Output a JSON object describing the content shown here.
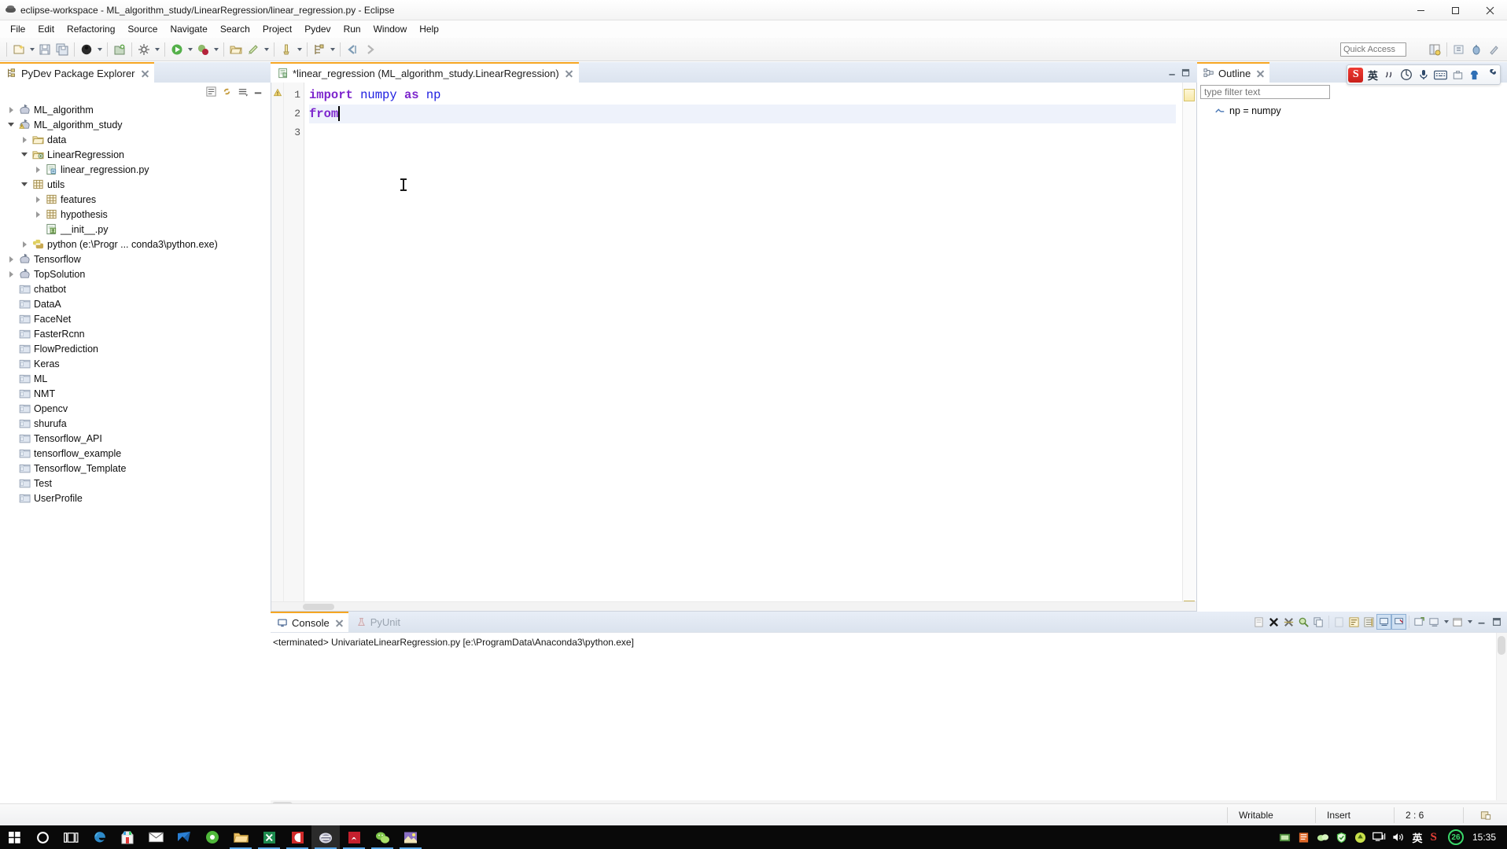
{
  "window": {
    "title": "eclipse-workspace - ML_algorithm_study/LinearRegression/linear_regression.py - Eclipse",
    "app_icon": "eclipse-icon",
    "minimize_label": "—",
    "maximize_label": "□",
    "close_label": "✕"
  },
  "menubar": {
    "items": [
      {
        "label": "File",
        "mnemonic": "F"
      },
      {
        "label": "Edit",
        "mnemonic": "E"
      },
      {
        "label": "Refactoring",
        "mnemonic": "a"
      },
      {
        "label": "Source",
        "mnemonic": "S"
      },
      {
        "label": "Navigate",
        "mnemonic": "N"
      },
      {
        "label": "Search",
        "mnemonic": "a"
      },
      {
        "label": "Project",
        "mnemonic": "P"
      },
      {
        "label": "Pydev",
        "mnemonic": "y"
      },
      {
        "label": "Run",
        "mnemonic": "R"
      },
      {
        "label": "Window",
        "mnemonic": "W"
      },
      {
        "label": "Help",
        "mnemonic": "H"
      }
    ]
  },
  "toolbar": {
    "buttons": [
      "new-wizard-icon",
      "new-dropdown-arrow",
      "save-icon",
      "save-all-icon",
      "debug-perspective-icon",
      "debug-dropdown-arrow",
      "new-python-project-icon",
      "customize-perspective-icon",
      "customize-dropdown-arrow",
      "run-icon",
      "run-dropdown-arrow",
      "debug-icon",
      "debug-menu-arrow",
      "open-folder-icon",
      "external-tools-icon",
      "external-tools-arrow",
      "pydev-run-icon",
      "pydev-run-arrow",
      "pydev-package-icon",
      "pydev-package-arrow",
      "back-icon",
      "forward-icon"
    ],
    "quick_access_placeholder": "Quick Access",
    "right_buttons": [
      "open-perspective-icon",
      "pydev-perspective-icon",
      "debug-perspective-2-icon",
      "java-perspective-icon"
    ]
  },
  "explorer": {
    "tab_title": "PyDev Package Explorer",
    "tab_icon": "pydev-package-explorer-icon",
    "close_icon": "close-icon",
    "toolbar_buttons": [
      "collapse-all-icon",
      "link-with-editor-icon",
      "view-menu-icon",
      "minimize-icon"
    ],
    "tree": [
      {
        "label": "ML_algorithm",
        "indent": 0,
        "twisty": "collapsed",
        "icon": "pydev-project-icon"
      },
      {
        "label": "ML_algorithm_study",
        "indent": 0,
        "twisty": "expanded",
        "icon": "pydev-project-warning-icon"
      },
      {
        "label": "data",
        "indent": 1,
        "twisty": "collapsed",
        "icon": "folder-icon"
      },
      {
        "label": "LinearRegression",
        "indent": 1,
        "twisty": "expanded",
        "icon": "source-folder-icon"
      },
      {
        "label": "linear_regression.py",
        "indent": 2,
        "twisty": "collapsed",
        "icon": "python-file-icon"
      },
      {
        "label": "utils",
        "indent": 1,
        "twisty": "expanded",
        "icon": "package-icon"
      },
      {
        "label": "features",
        "indent": 2,
        "twisty": "collapsed",
        "icon": "package-icon"
      },
      {
        "label": "hypothesis",
        "indent": 2,
        "twisty": "collapsed",
        "icon": "package-icon"
      },
      {
        "label": "__init__.py",
        "indent": 2,
        "twisty": "none",
        "icon": "python-init-file-icon"
      },
      {
        "label": "python  (e:\\Progr ... conda3\\python.exe)",
        "indent": 1,
        "twisty": "collapsed",
        "icon": "python-interpreter-icon"
      },
      {
        "label": "Tensorflow",
        "indent": 0,
        "twisty": "collapsed",
        "icon": "pydev-project-icon"
      },
      {
        "label": "TopSolution",
        "indent": 0,
        "twisty": "collapsed",
        "icon": "pydev-project-icon"
      },
      {
        "label": "chatbot",
        "indent": 0,
        "twisty": "none",
        "icon": "closed-project-icon"
      },
      {
        "label": "DataA",
        "indent": 0,
        "twisty": "none",
        "icon": "closed-project-icon"
      },
      {
        "label": "FaceNet",
        "indent": 0,
        "twisty": "none",
        "icon": "closed-project-icon"
      },
      {
        "label": "FasterRcnn",
        "indent": 0,
        "twisty": "none",
        "icon": "closed-project-icon"
      },
      {
        "label": "FlowPrediction",
        "indent": 0,
        "twisty": "none",
        "icon": "closed-project-icon"
      },
      {
        "label": "Keras",
        "indent": 0,
        "twisty": "none",
        "icon": "closed-project-icon"
      },
      {
        "label": "ML",
        "indent": 0,
        "twisty": "none",
        "icon": "closed-project-icon"
      },
      {
        "label": "NMT",
        "indent": 0,
        "twisty": "none",
        "icon": "closed-project-icon"
      },
      {
        "label": "Opencv",
        "indent": 0,
        "twisty": "none",
        "icon": "closed-project-icon"
      },
      {
        "label": "shurufa",
        "indent": 0,
        "twisty": "none",
        "icon": "closed-project-icon"
      },
      {
        "label": "Tensorflow_API",
        "indent": 0,
        "twisty": "none",
        "icon": "closed-project-icon"
      },
      {
        "label": "tensorflow_example",
        "indent": 0,
        "twisty": "none",
        "icon": "closed-project-icon"
      },
      {
        "label": "Tensorflow_Template",
        "indent": 0,
        "twisty": "none",
        "icon": "closed-project-icon"
      },
      {
        "label": "Test",
        "indent": 0,
        "twisty": "none",
        "icon": "closed-project-icon"
      },
      {
        "label": "UserProfile",
        "indent": 0,
        "twisty": "none",
        "icon": "closed-project-icon"
      }
    ]
  },
  "editor": {
    "tab_title": "*linear_regression (ML_algorithm_study.LinearRegression)",
    "tab_icon": "python-file-icon",
    "close_icon": "close-icon",
    "minimize_icon": "minimize-icon",
    "maximize_icon": "maximize-icon",
    "lines": [
      {
        "number": "1",
        "tokens": [
          {
            "text": "import",
            "type": "keyword"
          },
          {
            "text": " ",
            "type": "plain"
          },
          {
            "text": "numpy",
            "type": "name"
          },
          {
            "text": " ",
            "type": "plain"
          },
          {
            "text": "as",
            "type": "keyword"
          },
          {
            "text": " ",
            "type": "plain"
          },
          {
            "text": "np",
            "type": "name"
          }
        ],
        "marker": "warning-marker"
      },
      {
        "number": "2",
        "tokens": [
          {
            "text": "from",
            "type": "keyword"
          }
        ],
        "current": true
      },
      {
        "number": "3",
        "tokens": []
      }
    ]
  },
  "outline": {
    "tab_title": "Outline",
    "tab_icon": "outline-icon",
    "close_icon": "close-icon",
    "filter_placeholder": "type filter text",
    "items": [
      {
        "label": "np = numpy",
        "icon": "import-alias-icon"
      }
    ]
  },
  "ime": {
    "logo": "S",
    "mode_label": "英",
    "buttons": [
      "sogou-logo-icon",
      "input-mode-icon",
      "punctuation-icon",
      "emoji-icon",
      "voice-input-icon",
      "soft-keyboard-icon",
      "screenshot-icon",
      "skin-icon",
      "toolbox-icon"
    ]
  },
  "console": {
    "tabs": [
      {
        "label": "Console",
        "icon": "console-icon",
        "active": true,
        "closable": true
      },
      {
        "label": "PyUnit",
        "icon": "pyunit-icon",
        "active": false,
        "closable": false
      }
    ],
    "status_line": "<terminated> UnivariateLinearRegression.py [e:\\ProgramData\\Anaconda3\\python.exe]",
    "toolbar_buttons": [
      "clear-console-icon",
      "terminate-icon",
      "remove-all-terminated-icon",
      "find-replace-icon",
      "copy-icon",
      "paste-icon",
      "word-wrap-icon",
      "scroll-lock-icon",
      "show-console-icon",
      "pin-console-icon",
      "new-console-view-icon",
      "display-selected-console-icon",
      "display-dropdown-arrow",
      "open-console-icon",
      "open-console-dropdown-arrow",
      "minimize-icon",
      "maximize-icon"
    ]
  },
  "statusbar": {
    "writable": "Writable",
    "insert_mode": "Insert",
    "position": "2 : 6",
    "indicator_icon": "smart-insert-icon"
  },
  "taskbar": {
    "items": [
      {
        "name": "start-button-icon",
        "glyph": "windows"
      },
      {
        "name": "cortana-search-icon",
        "glyph": "circle"
      },
      {
        "name": "task-view-icon",
        "glyph": "taskview"
      },
      {
        "name": "edge-browser-icon",
        "glyph": "edge"
      },
      {
        "name": "store-icon",
        "glyph": "store"
      },
      {
        "name": "mail-icon",
        "glyph": "mail"
      },
      {
        "name": "foxmail-icon",
        "glyph": "foxmail"
      },
      {
        "name": "browser-icon",
        "glyph": "browser"
      },
      {
        "name": "file-explorer-icon",
        "glyph": "explorer",
        "running": true
      },
      {
        "name": "excel-icon",
        "glyph": "excel",
        "running": true
      },
      {
        "name": "pdf-reader-icon",
        "glyph": "pdfred",
        "running": true
      },
      {
        "name": "eclipse-icon",
        "glyph": "eclipse",
        "active": true,
        "running": true
      },
      {
        "name": "acrobat-icon",
        "glyph": "acrobat",
        "running": true
      },
      {
        "name": "wechat-icon",
        "glyph": "wechat",
        "running": true
      },
      {
        "name": "photos-icon",
        "glyph": "photos",
        "running": true
      }
    ],
    "tray": [
      {
        "name": "tray-notepad-icon",
        "glyph": "green-doc"
      },
      {
        "name": "tray-app-icon",
        "glyph": "orange-app"
      },
      {
        "name": "tray-cloud-icon",
        "glyph": "cloud"
      },
      {
        "name": "tray-security-icon",
        "glyph": "shield"
      },
      {
        "name": "tray-update-icon",
        "glyph": "update"
      },
      {
        "name": "tray-network-icon",
        "glyph": "network"
      },
      {
        "name": "tray-volume-icon",
        "glyph": "volume"
      }
    ],
    "ime_label": "英",
    "sogou_label": "S",
    "badge": "26",
    "clock": "15:35"
  }
}
